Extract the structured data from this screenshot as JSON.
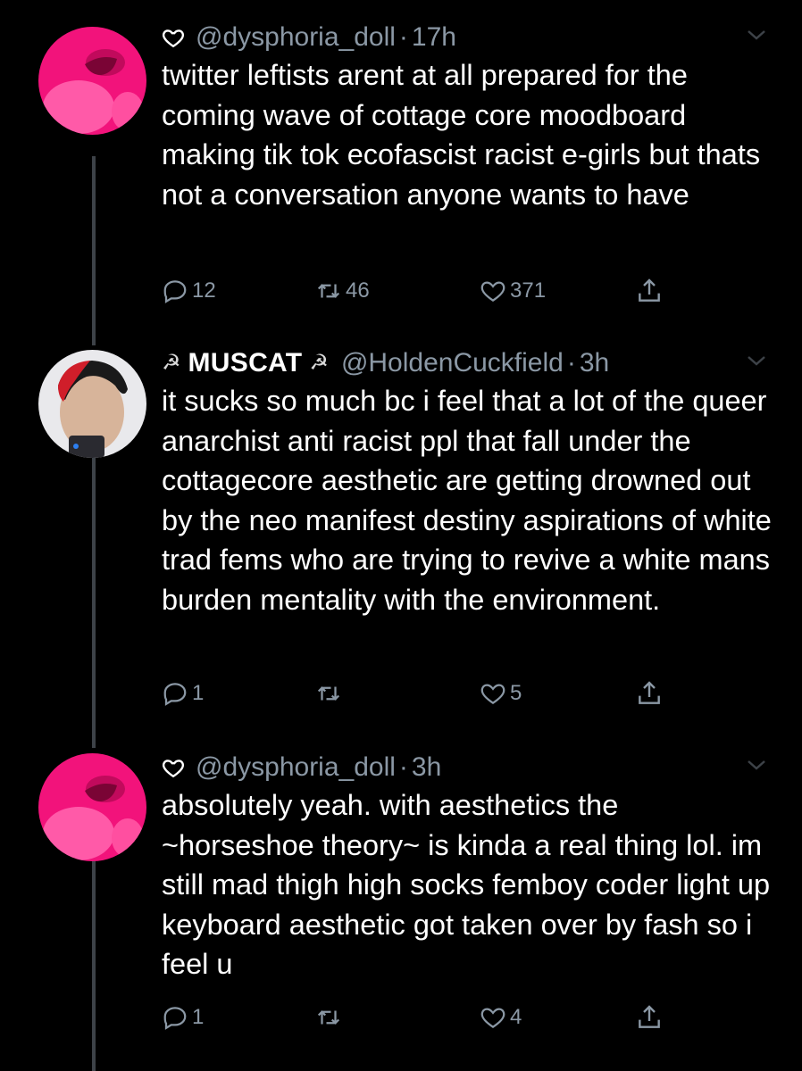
{
  "colors": {
    "background": "#000000",
    "text_primary": "#ffffff",
    "text_secondary": "#8b98a5",
    "thread_line": "#3d4248",
    "avatar_pink": "#f2137b"
  },
  "tweets": [
    {
      "handle": "@dysphoria_doll",
      "separator": "·",
      "time": "17h",
      "liked_by_icon": "heart-outline-icon",
      "text": "twitter leftists arent at all prepared for the coming wave of cottage core moodboard making tik tok ecofascist racist e-girls but thats not a conversation anyone wants to have",
      "replies": "12",
      "retweets": "46",
      "likes": "371"
    },
    {
      "display_name": "MUSCAT",
      "name_emoji": "☭",
      "handle": "@HoldenCuckfield",
      "separator": "·",
      "time": "3h",
      "text": "it sucks so much bc i feel that a lot of the queer anarchist anti racist ppl that fall under the cottagecore aesthetic are getting drowned out by the neo manifest destiny aspirations of white trad fems who are trying to revive a white mans burden mentality with the environment.",
      "replies": "1",
      "retweets": "",
      "likes": "5"
    },
    {
      "handle": "@dysphoria_doll",
      "separator": "·",
      "time": "3h",
      "liked_by_icon": "heart-outline-icon",
      "text": "absolutely yeah. with aesthetics the ~horseshoe theory~ is kinda a real thing lol. im still mad thigh high socks femboy coder light up keyboard aesthetic got taken over by fash so i feel u",
      "replies": "1",
      "retweets": "",
      "likes": "4"
    }
  ]
}
